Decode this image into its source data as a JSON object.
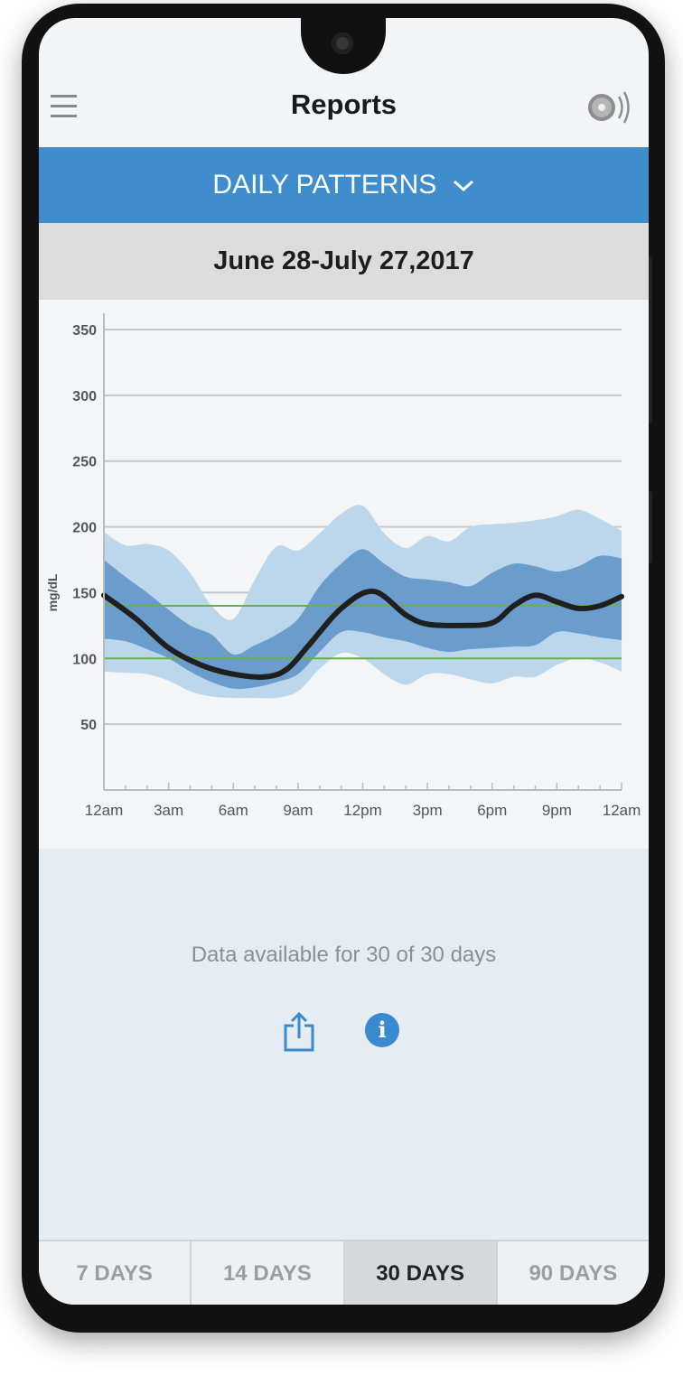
{
  "header": {
    "title": "Reports",
    "menu_icon": "hamburger-menu-icon",
    "sensor_icon": "sensor-signal-icon"
  },
  "report_selector": {
    "label": "DAILY PATTERNS",
    "icon": "chevron-down-icon"
  },
  "date_range": "June 28-July 27,2017",
  "chart_data": {
    "type": "area",
    "ylabel": "mg/dL",
    "ylim": [
      0,
      350
    ],
    "yticks": [
      50,
      100,
      150,
      200,
      250,
      300,
      350
    ],
    "xlim": [
      0,
      24
    ],
    "xticks": [
      {
        "h": 0,
        "label": "12am"
      },
      {
        "h": 3,
        "label": "3am"
      },
      {
        "h": 6,
        "label": "6am"
      },
      {
        "h": 9,
        "label": "9am"
      },
      {
        "h": 12,
        "label": "12pm"
      },
      {
        "h": 15,
        "label": "3pm"
      },
      {
        "h": 18,
        "label": "6pm"
      },
      {
        "h": 21,
        "label": "9pm"
      },
      {
        "h": 24,
        "label": "12am"
      }
    ],
    "grid": true,
    "target_range": [
      100,
      140
    ],
    "colors": {
      "outer_band": "#bcd7ec",
      "inner_band": "#6a9ccc",
      "median": "#1f1f1f",
      "target": "#6ab04c",
      "grid": "#c4c7ca"
    },
    "outer_band": {
      "hours": [
        0,
        1,
        2,
        3,
        4,
        5,
        6,
        7,
        8,
        9,
        10,
        11,
        12,
        13,
        14,
        15,
        16,
        17,
        18,
        19,
        20,
        21,
        22,
        23,
        24
      ],
      "upper": [
        196,
        186,
        187,
        182,
        165,
        140,
        130,
        160,
        185,
        182,
        195,
        210,
        216,
        195,
        184,
        193,
        189,
        200,
        202,
        203,
        205,
        208,
        213,
        206,
        197
      ],
      "lower": [
        90,
        89,
        88,
        83,
        75,
        71,
        70,
        70,
        70,
        75,
        92,
        104,
        100,
        88,
        80,
        88,
        88,
        84,
        81,
        86,
        86,
        95,
        100,
        97,
        90
      ]
    },
    "inner_band": {
      "hours": [
        0,
        1,
        2,
        3,
        4,
        5,
        6,
        7,
        8,
        9,
        10,
        11,
        12,
        13,
        14,
        15,
        16,
        17,
        18,
        19,
        20,
        21,
        22,
        23,
        24
      ],
      "upper": [
        175,
        162,
        150,
        137,
        125,
        118,
        103,
        110,
        118,
        130,
        155,
        172,
        183,
        172,
        162,
        160,
        158,
        155,
        165,
        172,
        170,
        166,
        170,
        178,
        176
      ],
      "lower": [
        115,
        113,
        107,
        100,
        90,
        82,
        77,
        78,
        82,
        88,
        105,
        120,
        120,
        116,
        113,
        108,
        105,
        107,
        108,
        109,
        110,
        120,
        119,
        116,
        114
      ]
    },
    "median": {
      "hours": [
        0,
        1.5,
        3,
        4.5,
        6,
        7.5,
        8.5,
        9.5,
        11,
        12.5,
        14,
        15,
        16.5,
        18,
        19,
        20,
        21,
        22,
        23,
        24
      ],
      "values": [
        148,
        130,
        108,
        95,
        88,
        86,
        92,
        110,
        138,
        151,
        133,
        126,
        125,
        127,
        140,
        148,
        143,
        138,
        140,
        147
      ]
    }
  },
  "availability": "Data available for 30 of 30 days",
  "actions": {
    "share_icon": "share-icon",
    "info_icon": "info-icon",
    "info_glyph": "i"
  },
  "tabs": [
    {
      "label": "7 DAYS",
      "active": false
    },
    {
      "label": "14 DAYS",
      "active": false
    },
    {
      "label": "30 DAYS",
      "active": true
    },
    {
      "label": "90 DAYS",
      "active": false
    }
  ]
}
